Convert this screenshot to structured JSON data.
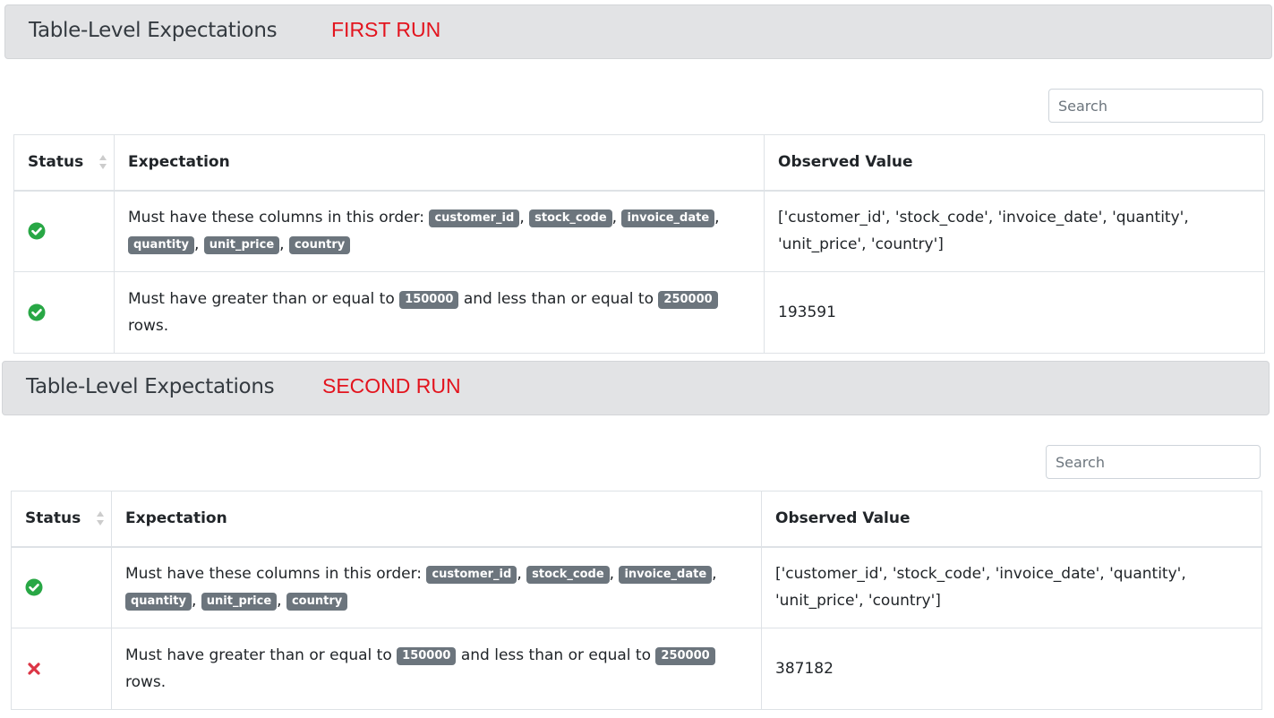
{
  "sections": [
    {
      "header_title": "Table-Level Expectations",
      "run_label": "FIRST RUN",
      "search_placeholder": "Search",
      "columns": {
        "status": "Status",
        "expectation": "Expectation",
        "observed": "Observed Value"
      },
      "rows": [
        {
          "status": "success",
          "expectation_prefix": "Must have these columns in this order:",
          "badges": [
            "customer_id",
            "stock_code",
            "invoice_date",
            "quantity",
            "unit_price",
            "country"
          ],
          "observed_line1": "['customer_id', 'stock_code', 'invoice_date', 'quantity',",
          "observed_line2": "'unit_price', 'country']"
        },
        {
          "status": "success",
          "text_a": "Must have greater than or equal to",
          "min_value": "150000",
          "text_b": "and less than or equal to",
          "max_value": "250000",
          "text_c": "rows.",
          "observed": "193591"
        }
      ]
    },
    {
      "header_title": "Table-Level Expectations",
      "run_label": "SECOND RUN",
      "search_placeholder": "Search",
      "columns": {
        "status": "Status",
        "expectation": "Expectation",
        "observed": "Observed Value"
      },
      "rows": [
        {
          "status": "success",
          "expectation_prefix": "Must have these columns in this order:",
          "badges": [
            "customer_id",
            "stock_code",
            "invoice_date",
            "quantity",
            "unit_price",
            "country"
          ],
          "observed_line1": "['customer_id', 'stock_code', 'invoice_date', 'quantity',",
          "observed_line2": "'unit_price', 'country']"
        },
        {
          "status": "failure",
          "text_a": "Must have greater than or equal to",
          "min_value": "150000",
          "text_b": "and less than or equal to",
          "max_value": "250000",
          "text_c": "rows.",
          "observed": "387182"
        }
      ]
    }
  ],
  "colors": {
    "success": "#28a745",
    "failure": "#dc3545",
    "run_label": "#e3141e",
    "badge": "#6c757d",
    "header_bg": "#e2e3e5"
  }
}
